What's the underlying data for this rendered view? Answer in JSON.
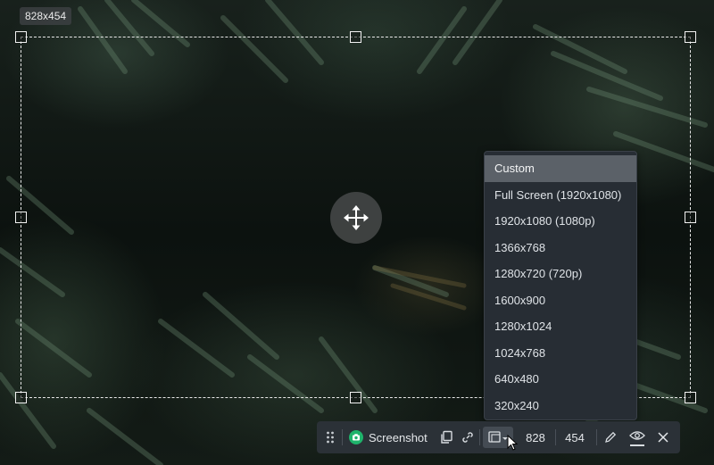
{
  "selection": {
    "size_label": "828x454"
  },
  "dropdown": {
    "items": [
      {
        "label": "Custom",
        "selected": true
      },
      {
        "label": "Full Screen (1920x1080)",
        "selected": false
      },
      {
        "label": "1920x1080 (1080p)",
        "selected": false
      },
      {
        "label": "1366x768",
        "selected": false
      },
      {
        "label": "1280x720 (720p)",
        "selected": false
      },
      {
        "label": "1600x900",
        "selected": false
      },
      {
        "label": "1280x1024",
        "selected": false
      },
      {
        "label": "1024x768",
        "selected": false
      },
      {
        "label": "640x480",
        "selected": false
      },
      {
        "label": "320x240",
        "selected": false
      }
    ]
  },
  "toolbar": {
    "mode_label": "Screenshot",
    "width_value": "828",
    "height_value": "454"
  },
  "colors": {
    "accent_green": "#1fb36b",
    "toolbar_bg": "#2b3137",
    "dropdown_bg": "#272d34",
    "selected_item_bg": "#5b6168"
  },
  "icons": {
    "drag": "drag-handle-icon",
    "mode": "camera-icon",
    "copy": "copy-icon",
    "link": "link-icon",
    "region": "region-select-icon",
    "edit": "pencil-icon",
    "preview": "eye-icon",
    "close": "close-icon",
    "move": "move-arrows-icon"
  }
}
